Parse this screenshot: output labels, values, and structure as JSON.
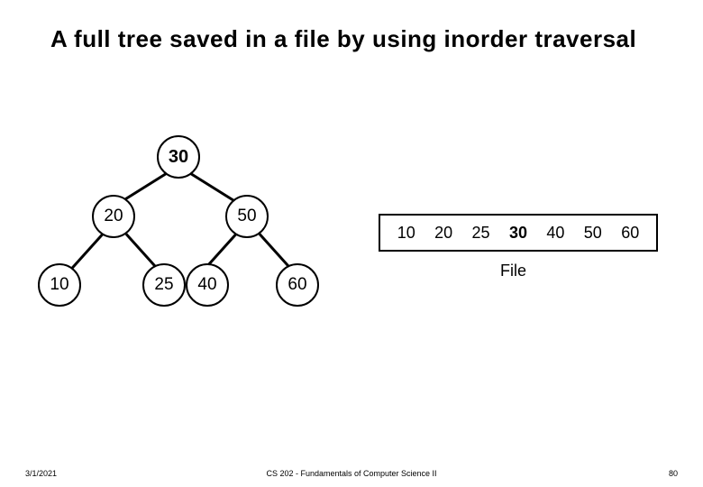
{
  "title": "A full tree saved in a file by using inorder traversal",
  "tree": {
    "root": "30",
    "l": "20",
    "r": "50",
    "ll": "10",
    "lr": "25",
    "rl": "40",
    "rr": "60"
  },
  "file": {
    "items": [
      "10",
      "20",
      "25",
      "30",
      "40",
      "50",
      "60"
    ],
    "bold_index": 3,
    "label": "File"
  },
  "footer": {
    "date": "3/1/2021",
    "course": "CS 202 - Fundamentals of Computer Science II",
    "page": "80"
  }
}
